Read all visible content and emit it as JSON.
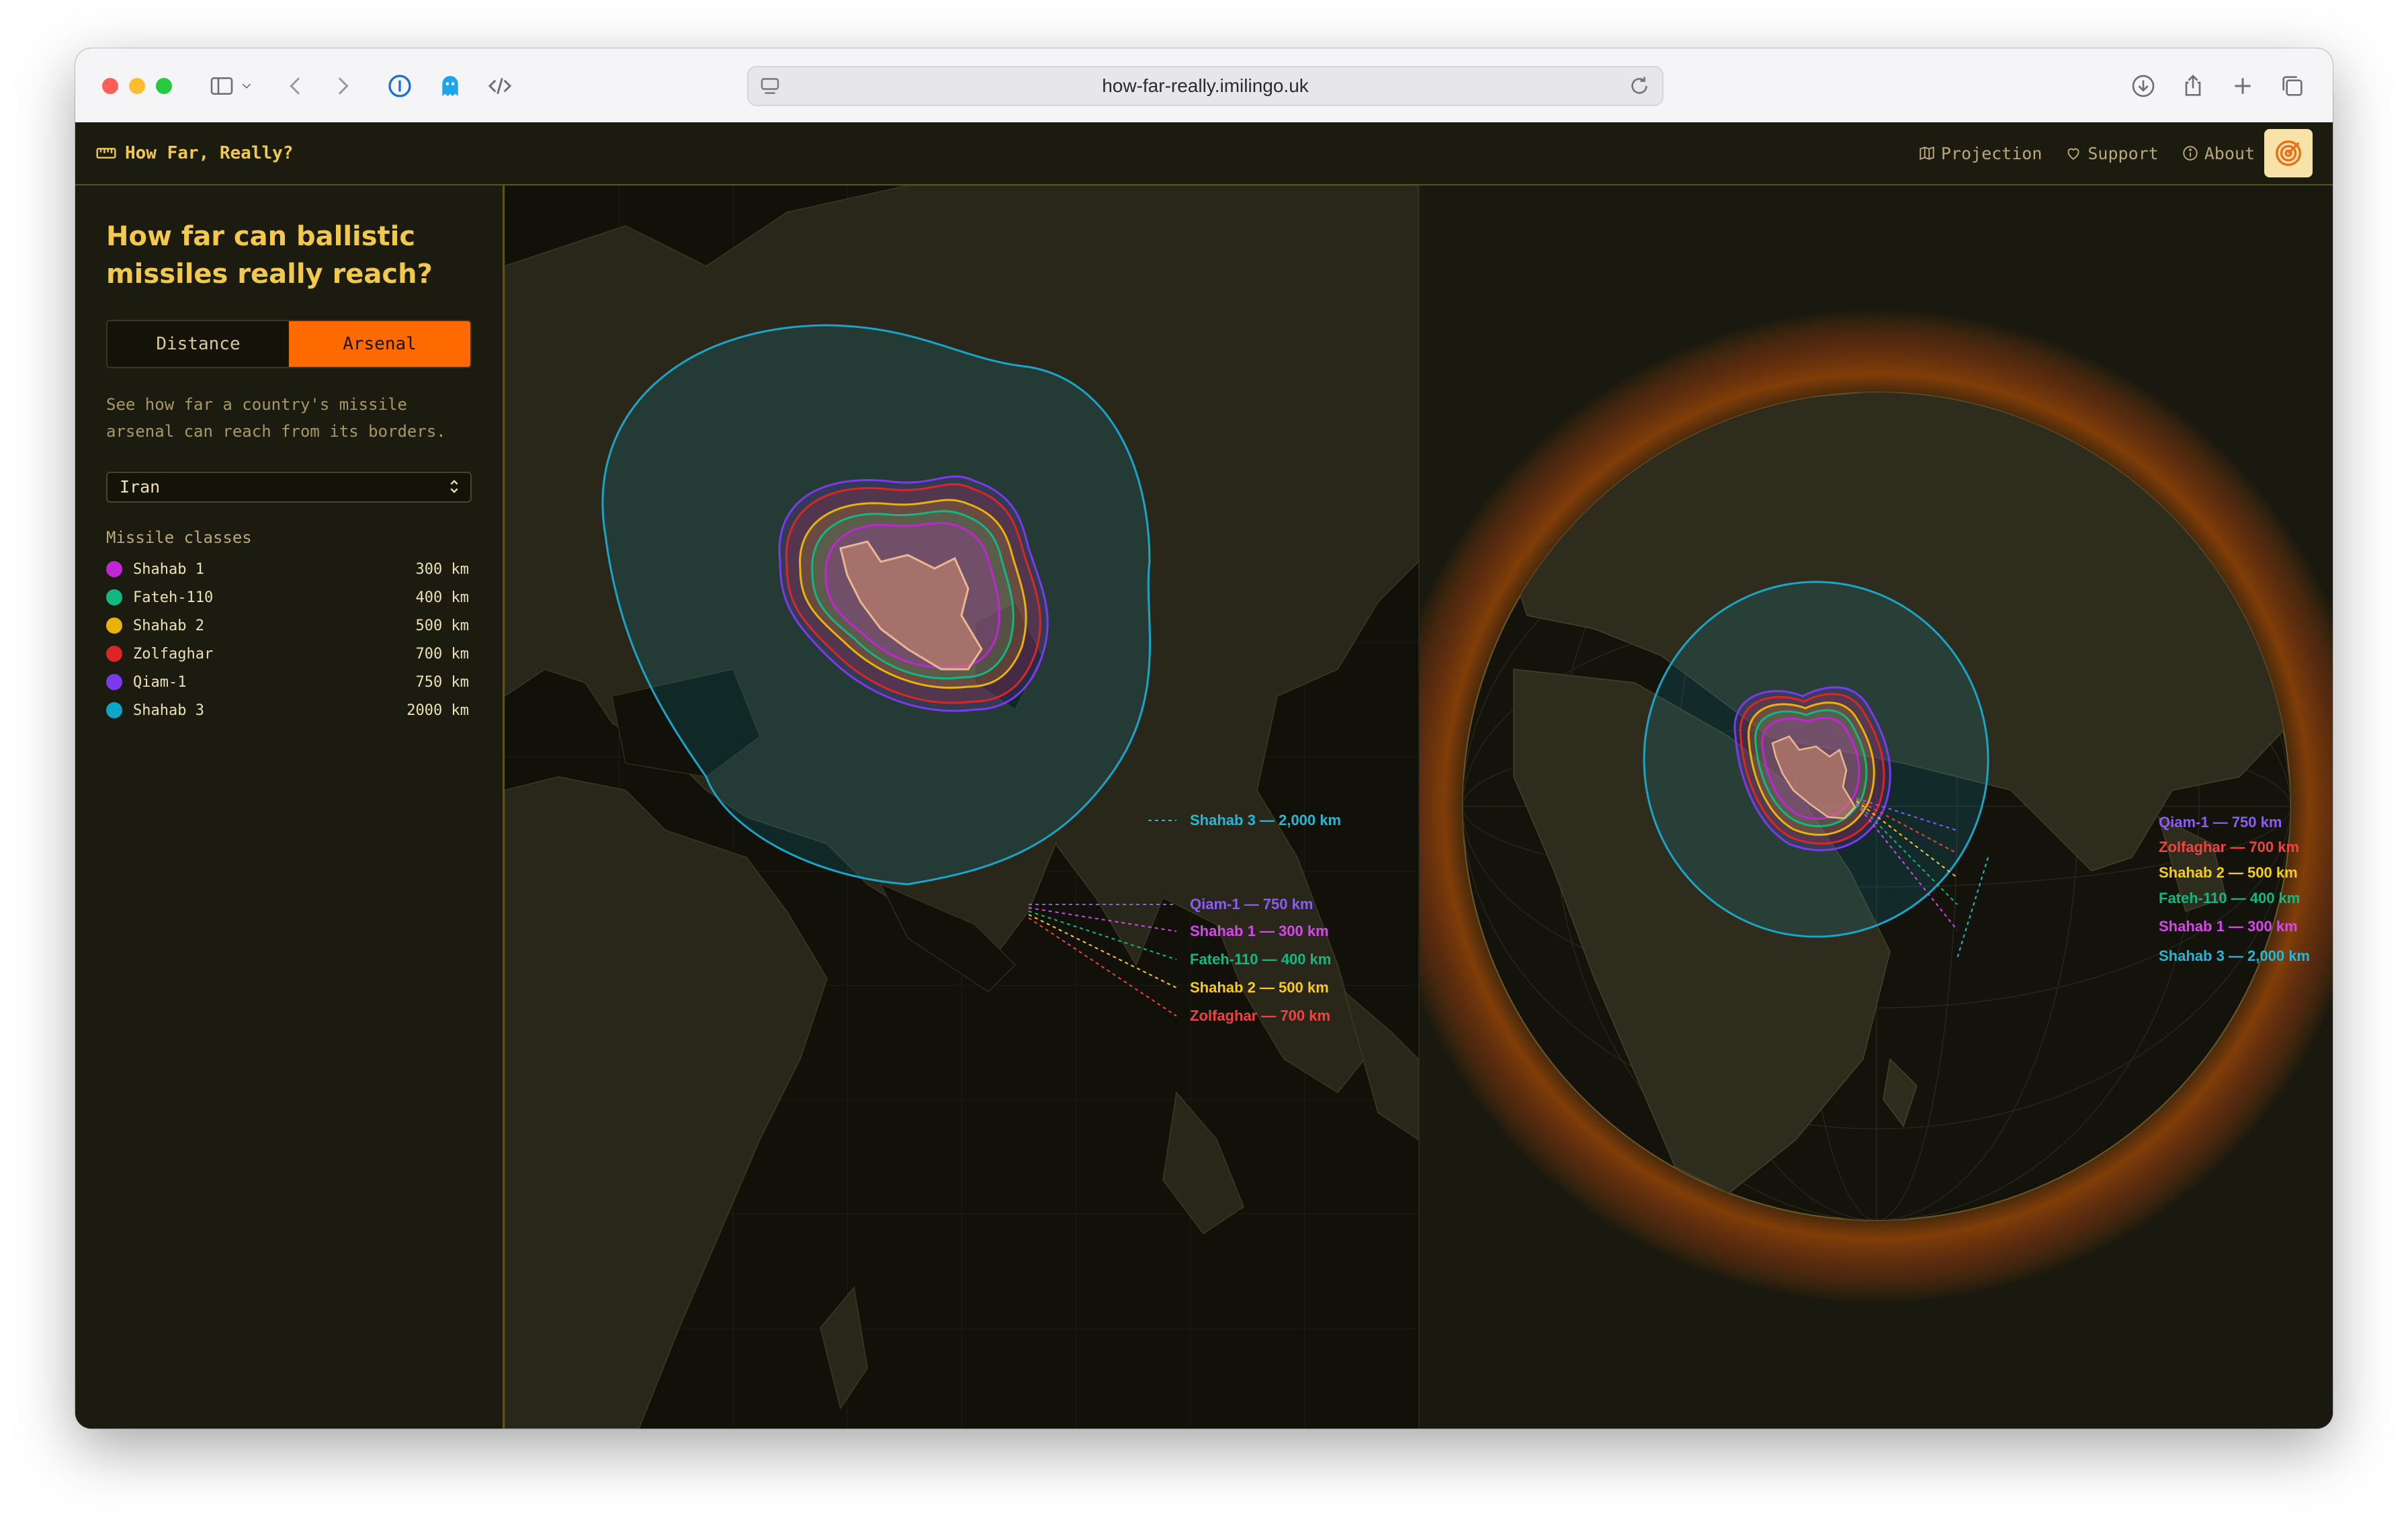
{
  "browser": {
    "url": "how-far-really.imilingo.uk"
  },
  "app": {
    "brand": "How Far, Really?",
    "nav": [
      {
        "label": "Projection",
        "icon": "map-icon"
      },
      {
        "label": "Support",
        "icon": "heart-icon"
      },
      {
        "label": "About",
        "icon": "info-icon"
      }
    ]
  },
  "sidebar": {
    "title": "How far can ballistic missiles really reach?",
    "modes": [
      "Distance",
      "Arsenal"
    ],
    "active_mode": "Arsenal",
    "description": "See how far a country's missile arsenal can reach from its borders.",
    "country_select": "Iran",
    "classes_title": "Missile classes",
    "classes": [
      {
        "name": "Shahab 1",
        "range": "300 km",
        "color": "#c026d3"
      },
      {
        "name": "Fateh-110",
        "range": "400 km",
        "color": "#10b981"
      },
      {
        "name": "Shahab 2",
        "range": "500 km",
        "color": "#eab308"
      },
      {
        "name": "Zolfaghar",
        "range": "700 km",
        "color": "#dc2626"
      },
      {
        "name": "Qiam-1",
        "range": "750 km",
        "color": "#7c3aed"
      },
      {
        "name": "Shahab 3",
        "range": "2000 km",
        "color": "#0ea5c6"
      }
    ]
  },
  "flat_map": {
    "labels": [
      {
        "text": "Shahab 3 — 2,000 km",
        "color": "#22b8d8"
      },
      {
        "text": "Qiam-1 — 750 km",
        "color": "#8b5cf6"
      },
      {
        "text": "Shahab 1 — 300 km",
        "color": "#d946ef"
      },
      {
        "text": "Fateh-110 — 400 km",
        "color": "#10b981"
      },
      {
        "text": "Shahab 2 — 500 km",
        "color": "#facc15"
      },
      {
        "text": "Zolfaghar — 700 km",
        "color": "#ef4444"
      }
    ]
  },
  "globe_map": {
    "labels": [
      {
        "text": "Qiam-1 — 750 km",
        "color": "#8b5cf6"
      },
      {
        "text": "Zolfaghar — 700 km",
        "color": "#ef4444"
      },
      {
        "text": "Shahab 2 — 500 km",
        "color": "#facc15"
      },
      {
        "text": "Fateh-110 — 400 km",
        "color": "#10b981"
      },
      {
        "text": "Shahab 1 — 300 km",
        "color": "#d946ef"
      },
      {
        "text": "Shahab 3 — 2,000 km",
        "color": "#22b8d8"
      }
    ]
  },
  "colors": {
    "accent": "#ff6a00",
    "title": "#f2c94c",
    "background": "#1c1b10"
  }
}
